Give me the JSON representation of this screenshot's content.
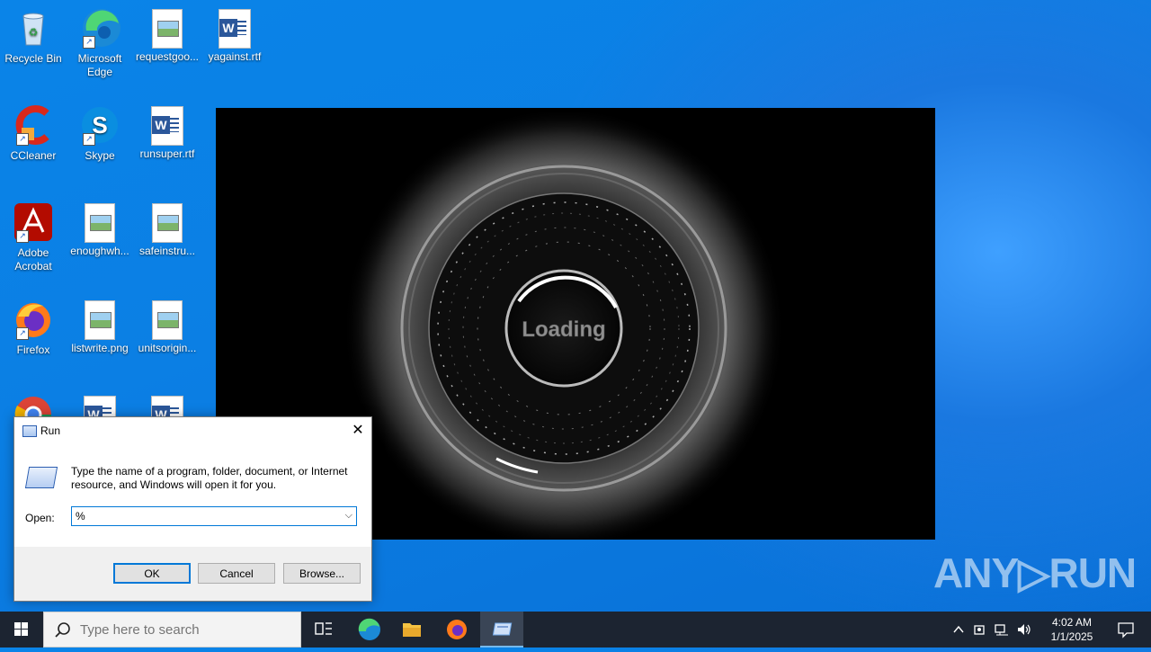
{
  "desktop": {
    "icons": [
      {
        "label": "Recycle Bin"
      },
      {
        "label": "Microsoft Edge"
      },
      {
        "label": "requestgoo..."
      },
      {
        "label": "yagainst.rtf"
      },
      {
        "label": "CCleaner"
      },
      {
        "label": "Skype"
      },
      {
        "label": "runsuper.rtf"
      },
      {
        "label": "Adobe Acrobat"
      },
      {
        "label": "enoughwh..."
      },
      {
        "label": "safeinstru..."
      },
      {
        "label": "Firefox"
      },
      {
        "label": "listwrite.png"
      },
      {
        "label": "unitsorigin..."
      }
    ]
  },
  "loader": {
    "text": "Loading"
  },
  "run_dialog": {
    "title": "Run",
    "close_glyph": "✕",
    "description": "Type the name of a program, folder, document, or Internet resource, and Windows will open it for you.",
    "open_label": "Open:",
    "open_value": "%",
    "ok_label": "OK",
    "cancel_label": "Cancel",
    "browse_label": "Browse..."
  },
  "watermark": {
    "text": "ANY▷RUN"
  },
  "taskbar": {
    "search_placeholder": "Type here to search",
    "clock_time": "4:02 AM",
    "clock_date": "1/1/2025"
  },
  "colors": {
    "accent": "#0078d7",
    "taskbar": "#1c2431"
  }
}
